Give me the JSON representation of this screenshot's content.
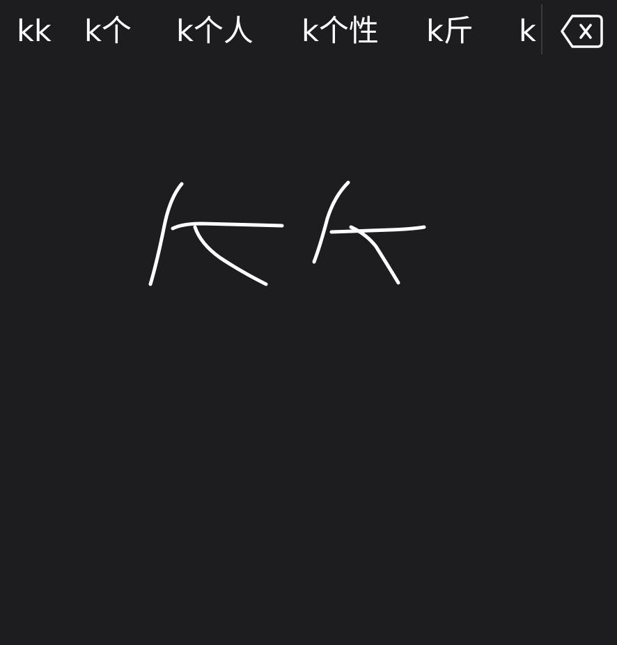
{
  "candidate_bar": {
    "candidates": [
      "kk",
      "k个",
      "k个人",
      "k个性",
      "k斤",
      "k"
    ]
  },
  "delete_key": {
    "icon": "backspace-icon"
  },
  "handwriting_canvas": {
    "ink_color": "#ffffff",
    "background_color": "#1d1c1f"
  }
}
